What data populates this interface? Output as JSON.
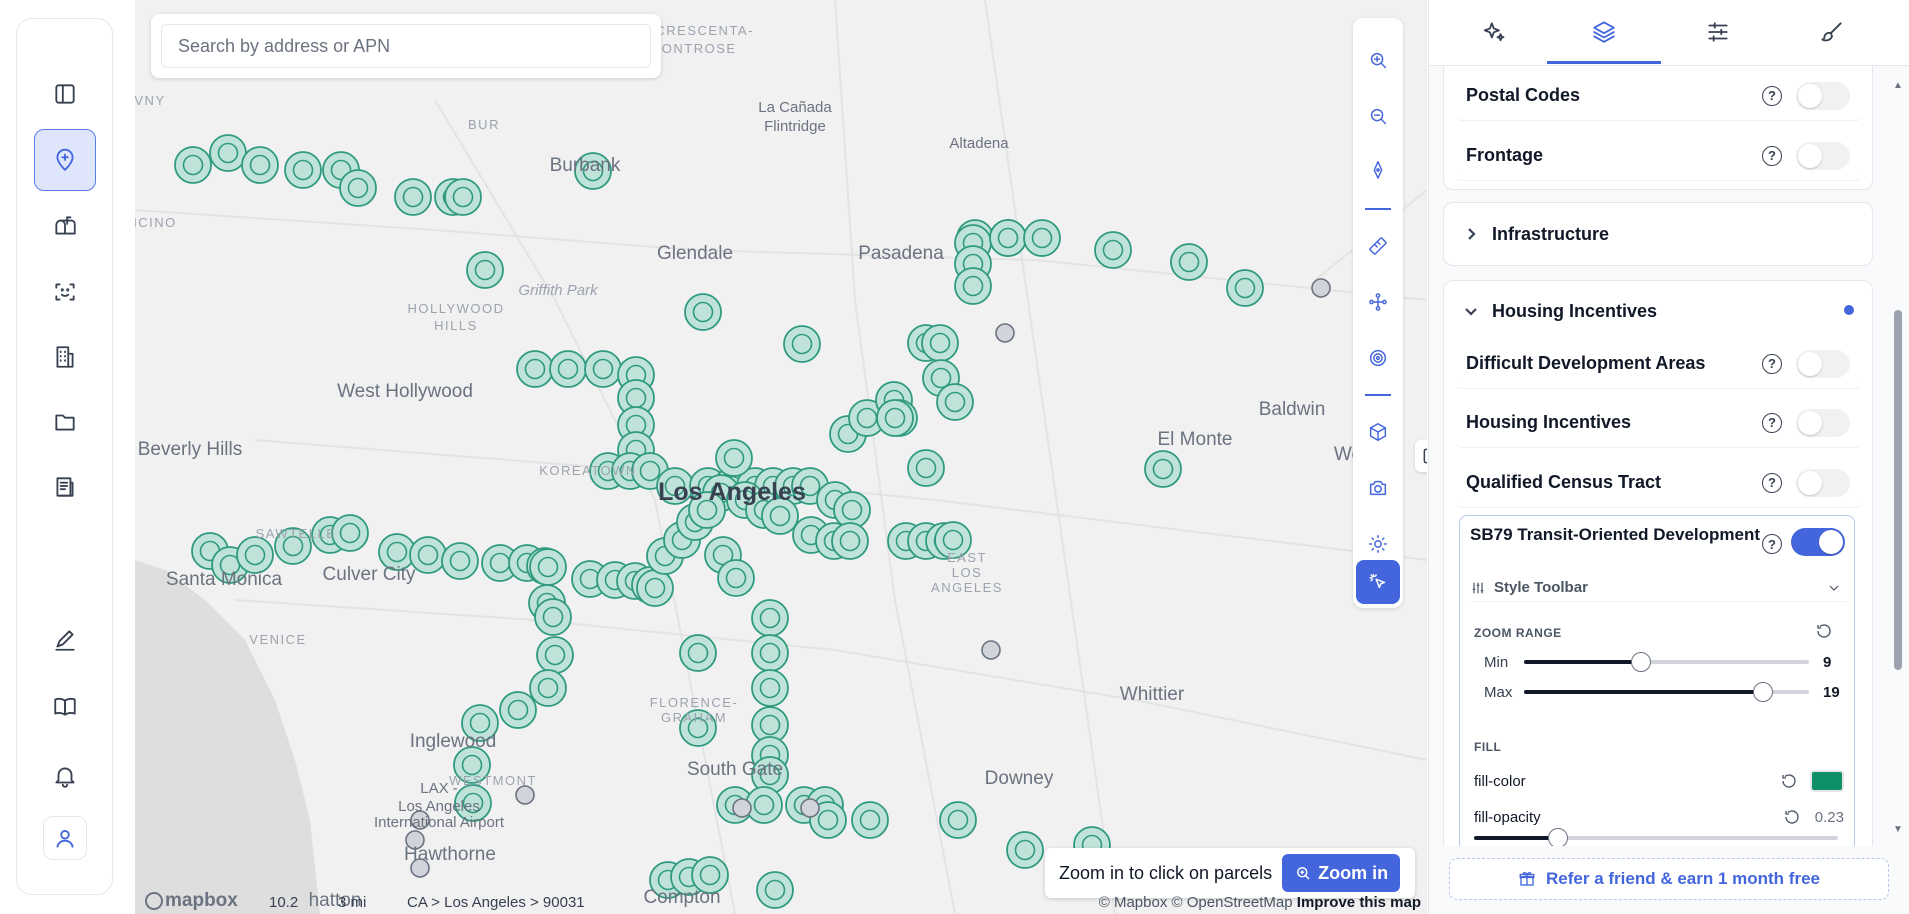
{
  "search": {
    "placeholder": "Search by address or APN"
  },
  "map": {
    "labels": [
      {
        "text": "LA CRESCENTA-",
        "kind": "hood"
      },
      {
        "text": "MONTROSE",
        "kind": "hood"
      },
      {
        "text": "VNY",
        "kind": "hood"
      },
      {
        "text": "BUR",
        "kind": "hood"
      },
      {
        "text": "La Cañada",
        "kind": "town"
      },
      {
        "text": "Flintridge",
        "kind": "town"
      },
      {
        "text": "Altadena",
        "kind": "town"
      },
      {
        "text": "Burbank",
        "kind": "city"
      },
      {
        "text": "ENCINO",
        "kind": "hood"
      },
      {
        "text": "Glendale",
        "kind": "city"
      },
      {
        "text": "Pasadena",
        "kind": "city"
      },
      {
        "text": "Griffith Park",
        "kind": "park"
      },
      {
        "text": "HOLLYWOOD",
        "kind": "hood"
      },
      {
        "text": "HILLS",
        "kind": "hood"
      },
      {
        "text": "West Hollywood",
        "kind": "city"
      },
      {
        "text": "Baldwin",
        "kind": "city"
      },
      {
        "text": "Beverly Hills",
        "kind": "city"
      },
      {
        "text": "El Monte",
        "kind": "city"
      },
      {
        "text": "We",
        "kind": "city"
      },
      {
        "text": "Los Angeles",
        "kind": "major"
      },
      {
        "text": "KOREATOWN",
        "kind": "hood"
      },
      {
        "text": "SAWTELLE",
        "kind": "hood"
      },
      {
        "text": "Santa Monica",
        "kind": "city"
      },
      {
        "text": "Culver City",
        "kind": "city"
      },
      {
        "text": "EAST",
        "kind": "hood"
      },
      {
        "text": "LOS",
        "kind": "hood"
      },
      {
        "text": "ANGELES",
        "kind": "hood"
      },
      {
        "text": "VENICE",
        "kind": "hood"
      },
      {
        "text": "Whittier",
        "kind": "city"
      },
      {
        "text": "FLORENCE-",
        "kind": "hood"
      },
      {
        "text": "GRAHAM",
        "kind": "hood"
      },
      {
        "text": "Inglewood",
        "kind": "city"
      },
      {
        "text": "WESTMONT",
        "kind": "hood"
      },
      {
        "text": "South Gate",
        "kind": "city"
      },
      {
        "text": "Downey",
        "kind": "city"
      },
      {
        "text": "LAX -",
        "kind": "town"
      },
      {
        "text": "Los Angeles",
        "kind": "town"
      },
      {
        "text": "International Airport",
        "kind": "town"
      },
      {
        "text": "Hawthorne",
        "kind": "city"
      },
      {
        "text": "Compton",
        "kind": "city"
      },
      {
        "text": "hatton",
        "kind": "city"
      }
    ],
    "zoom_hint": "Zoom in to click on parcels",
    "zoom_in_label": "Zoom in",
    "footer": {
      "logo": "mapbox",
      "zoom_level": "10.2",
      "scale": "3 mi",
      "breadcrumb": "CA > Los Angeles > 90031",
      "attribution": "© Mapbox © OpenStreetMap",
      "improve": "Improve this map"
    },
    "colors": {
      "marker_fill": "#bfe3d9",
      "marker_stroke": "#2f9a7f",
      "marker_gray": "#9ca3af",
      "background": "#f1f1f1"
    }
  },
  "left_rail": {
    "items": [
      {
        "name": "sidebar-toggle",
        "icon": "panel-icon"
      },
      {
        "name": "map-pin",
        "icon": "map-pin-icon",
        "active": true
      },
      {
        "name": "mailbox",
        "icon": "mailbox-icon"
      },
      {
        "name": "scan-face",
        "icon": "scan-face-icon"
      },
      {
        "name": "buildings",
        "icon": "building-icon"
      },
      {
        "name": "folder",
        "icon": "folder-icon"
      },
      {
        "name": "reports",
        "icon": "document-icon"
      },
      {
        "name": "edit",
        "icon": "pencil-icon"
      },
      {
        "name": "guide",
        "icon": "book-icon"
      },
      {
        "name": "notifications",
        "icon": "bell-icon"
      },
      {
        "name": "account",
        "icon": "user-icon"
      }
    ]
  },
  "tools": [
    "zoom-in-icon",
    "zoom-out-icon",
    "compass-icon",
    "ruler-icon",
    "draw-icon",
    "target-icon",
    "cube-icon",
    "camera-icon",
    "sun-icon",
    "pointer-icon"
  ],
  "panel": {
    "tabs": [
      "sparkle-icon",
      "layers-icon",
      "sliders-icon",
      "brush-icon"
    ],
    "top_rows": [
      {
        "label": "Postal Codes",
        "on": false
      },
      {
        "label": "Frontage",
        "on": false
      }
    ],
    "infrastructure": {
      "title": "Infrastructure"
    },
    "housing": {
      "title": "Housing Incentives",
      "rows": [
        {
          "label": "Difficult Development Areas",
          "on": false
        },
        {
          "label": "Housing Incentives",
          "on": false
        },
        {
          "label": "Qualified Census Tract",
          "on": false
        }
      ],
      "sb79": {
        "title": "SB79 Transit-Oriented Development",
        "on": true,
        "style_toolbar": "Style Toolbar",
        "zoom_range_label": "ZOOM RANGE",
        "min_label": "Min",
        "min_value": "9",
        "max_label": "Max",
        "max_value": "19",
        "min_level": 0.41,
        "max_level": 0.84,
        "fill_label": "FILL",
        "fill_color_label": "fill-color",
        "fill_color": "#0e8f67",
        "fill_opacity_label": "fill-opacity",
        "fill_opacity": "0.23"
      }
    },
    "refer": "Refer a friend & earn 1 month free"
  },
  "colors": {
    "accent": "#4466dd"
  }
}
